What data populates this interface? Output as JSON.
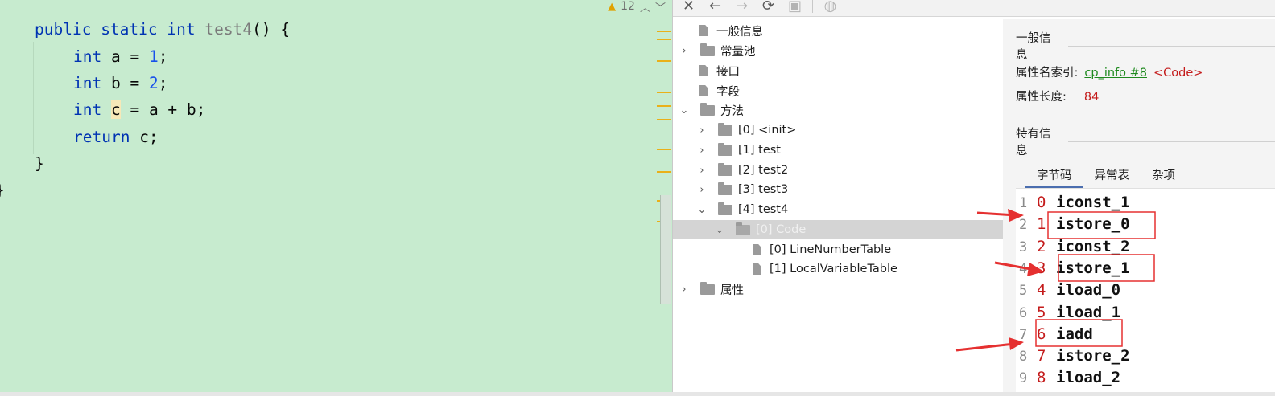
{
  "editor": {
    "inspection_count": "12",
    "brace_right": "}",
    "outer_brace": "}",
    "lines": {
      "l1": {
        "kw1": "public",
        "kw2": "static",
        "kw3": "int",
        "name": "test4",
        "rest": "() {"
      },
      "l2": {
        "kw": "int",
        "pre": " a = ",
        "num": "1",
        "post": ";"
      },
      "l3": {
        "kw": "int",
        "pre": " b = ",
        "num": "2",
        "post": ";"
      },
      "l4": {
        "kw": "int",
        "sp": " ",
        "var": "c",
        "post": " = a + b;"
      },
      "l5": {
        "kw": "return",
        "post": " c;"
      }
    }
  },
  "toolbar": {
    "icons": [
      "close-icon",
      "back-arrow-icon",
      "forward-arrow-icon",
      "refresh-icon",
      "save-icon",
      "globe-icon"
    ]
  },
  "tree": {
    "general": "一般信息",
    "constant_pool": "常量池",
    "interfaces": "接口",
    "fields": "字段",
    "methods": "方法",
    "m0": "[0] <init>",
    "m1": "[1] test",
    "m2": "[2] test2",
    "m3": "[3] test3",
    "m4": "[4] test4",
    "code": "[0] Code",
    "lnt": "[0] LineNumberTable",
    "lvt": "[1] LocalVariableTable",
    "attributes": "属性"
  },
  "detail": {
    "general_header": "一般信息",
    "name_index_label": "属性名索引:",
    "name_index_link": "cp_info #8",
    "name_index_value": "<Code>",
    "length_label": "属性长度:",
    "length_value": "84",
    "specific_header": "特有信息",
    "tabs": [
      "字节码",
      "异常表",
      "杂项"
    ],
    "bytecode": [
      {
        "line": "1",
        "offset": "0",
        "op": "iconst_1"
      },
      {
        "line": "2",
        "offset": "1",
        "op": "istore_0"
      },
      {
        "line": "3",
        "offset": "2",
        "op": "iconst_2"
      },
      {
        "line": "4",
        "offset": "3",
        "op": "istore_1"
      },
      {
        "line": "5",
        "offset": "4",
        "op": "iload_0"
      },
      {
        "line": "6",
        "offset": "5",
        "op": "iload_1"
      },
      {
        "line": "7",
        "offset": "6",
        "op": "iadd"
      },
      {
        "line": "8",
        "offset": "7",
        "op": "istore_2"
      },
      {
        "line": "9",
        "offset": "8",
        "op": "iload_2"
      }
    ]
  },
  "colors": {
    "editor_bg": "#c7ebcf",
    "keyword": "#0033b3",
    "number": "#1750eb",
    "annotation_red": "#e53030",
    "bytecode_offset": "#c41b1b"
  }
}
